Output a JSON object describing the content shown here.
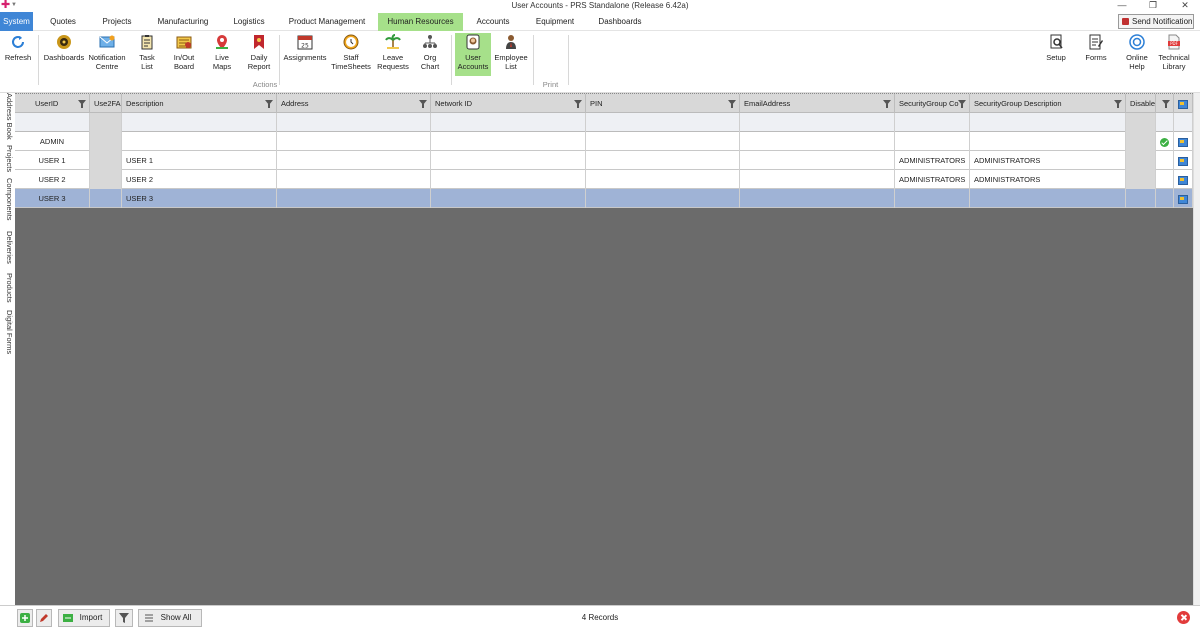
{
  "window": {
    "title": "User Accounts - PRS Standalone (Release 6.42a)",
    "minimize": "—",
    "restore": "❐",
    "close": "✕"
  },
  "menu": {
    "tabs": [
      "System",
      "Quotes",
      "Projects",
      "Manufacturing",
      "Logistics",
      "Product Management",
      "Human Resources",
      "Accounts",
      "Equipment",
      "Dashboards"
    ],
    "active_tab": "Human Resources",
    "send_notification": "Send Notification"
  },
  "ribbon": {
    "buttons": [
      {
        "label1": "Refresh",
        "label2": "",
        "icon": "refresh-icon"
      },
      {
        "label1": "Dashboards",
        "label2": "",
        "icon": "dashboards-icon"
      },
      {
        "label1": "Notification",
        "label2": "Centre",
        "icon": "notification-icon"
      },
      {
        "label1": "Task",
        "label2": "List",
        "icon": "task-list-icon"
      },
      {
        "label1": "In/Out",
        "label2": "Board",
        "icon": "inout-board-icon"
      },
      {
        "label1": "Live",
        "label2": "Maps",
        "icon": "map-pin-icon"
      },
      {
        "label1": "Daily",
        "label2": "Report",
        "icon": "bookmark-icon"
      },
      {
        "label1": "Assignments",
        "label2": "",
        "icon": "calendar-icon"
      },
      {
        "label1": "Staff",
        "label2": "TimeSheets",
        "icon": "clock-icon"
      },
      {
        "label1": "Leave",
        "label2": "Requests",
        "icon": "palm-tree-icon"
      },
      {
        "label1": "Org",
        "label2": "Chart",
        "icon": "org-chart-icon"
      },
      {
        "label1": "User",
        "label2": "Accounts",
        "icon": "user-badge-icon"
      },
      {
        "label1": "Employee",
        "label2": "List",
        "icon": "employee-icon"
      },
      {
        "label1": "Setup",
        "label2": "",
        "icon": "setup-icon"
      },
      {
        "label1": "Forms",
        "label2": "",
        "icon": "forms-icon"
      },
      {
        "label1": "Online",
        "label2": "Help",
        "icon": "help-icon"
      },
      {
        "label1": "Technical",
        "label2": "Library",
        "icon": "pdf-icon"
      }
    ],
    "groups": {
      "actions": "Actions",
      "print": "Print"
    },
    "pdf_text": "PDF"
  },
  "left_tabs": [
    "Address Book",
    "Projects",
    "Components",
    "Deliveries",
    "Products",
    "Digital Forms"
  ],
  "grid": {
    "columns": [
      "UserID",
      "Use2FA",
      "Description",
      "Address",
      "Network ID",
      "PIN",
      "EmailAddress",
      "SecurityGroup Co",
      "SecurityGroup Description",
      "Disable",
      "",
      ""
    ],
    "rows": [
      {
        "userid": "ADMIN",
        "use2fa": "",
        "description": "",
        "address": "",
        "network_id": "",
        "pin": "",
        "email": "",
        "sg_code": "",
        "sg_desc": "",
        "disabled": "",
        "checked": true,
        "selected": false
      },
      {
        "userid": "USER 1",
        "use2fa": "",
        "description": "USER 1",
        "address": "",
        "network_id": "",
        "pin": "",
        "email": "",
        "sg_code": "ADMINISTRATORS",
        "sg_desc": "ADMINISTRATORS",
        "disabled": "",
        "checked": false,
        "selected": false
      },
      {
        "userid": "USER 2",
        "use2fa": "",
        "description": "USER 2",
        "address": "",
        "network_id": "",
        "pin": "",
        "email": "",
        "sg_code": "ADMINISTRATORS",
        "sg_desc": "ADMINISTRATORS",
        "disabled": "",
        "checked": false,
        "selected": false
      },
      {
        "userid": "USER 3",
        "use2fa": "",
        "description": "USER 3",
        "address": "",
        "network_id": "",
        "pin": "",
        "email": "",
        "sg_code": "",
        "sg_desc": "",
        "disabled": "",
        "checked": false,
        "selected": true
      }
    ]
  },
  "status": {
    "import": "Import",
    "show_all": "Show All",
    "records": "4 Records"
  },
  "colors": {
    "system_tab": "#3f86d6",
    "active_tab": "#a6e08a",
    "selected_row": "#9fb3d6",
    "grid_background": "#6b6b6b"
  }
}
